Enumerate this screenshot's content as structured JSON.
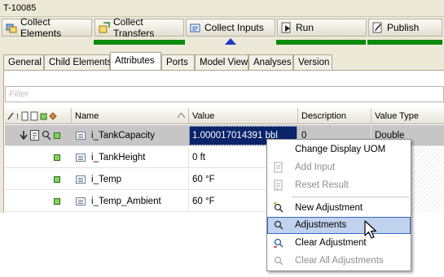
{
  "window": {
    "title": "T-10085"
  },
  "toolbar": {
    "buttons": [
      {
        "label": "Collect Elements",
        "icon": "collect-elements-icon"
      },
      {
        "label": "Collect Transfers",
        "icon": "collect-transfers-icon"
      },
      {
        "label": "Collect Inputs",
        "icon": "collect-inputs-icon"
      },
      {
        "label": "Run",
        "icon": "run-icon"
      },
      {
        "label": "Publish",
        "icon": "publish-icon"
      }
    ]
  },
  "tabs": [
    "General",
    "Child Elements",
    "Attributes",
    "Ports",
    "Model View",
    "Analyses",
    "Version"
  ],
  "active_tab": "Attributes",
  "filter": {
    "placeholder": "Filter"
  },
  "grid": {
    "columns": [
      "Name",
      "Value",
      "Description",
      "Value Type"
    ],
    "rows": [
      {
        "name": "i_TankCapacity",
        "value": "1.000017014391 bbl",
        "description": "0",
        "value_type": "Double",
        "selected": true
      },
      {
        "name": "i_TankHeight",
        "value": "0 ft",
        "description": "",
        "value_type": "",
        "selected": false
      },
      {
        "name": "i_Temp",
        "value": "60 °F",
        "description": "",
        "value_type": "",
        "selected": false
      },
      {
        "name": "i_Temp_Ambient",
        "value": "60 °F",
        "description": "",
        "value_type": "",
        "selected": false
      }
    ]
  },
  "context_menu": {
    "items": [
      {
        "label": "Change Display UOM",
        "enabled": true
      },
      {
        "label": "Add Input",
        "enabled": false
      },
      {
        "label": "Reset Result",
        "enabled": false
      },
      {
        "label": "New Adjustment",
        "enabled": true
      },
      {
        "label": "Adjustments",
        "enabled": true,
        "highlighted": true
      },
      {
        "label": "Clear Adjustment",
        "enabled": true
      },
      {
        "label": "Clear All Adjustments",
        "enabled": false
      }
    ]
  },
  "colors": {
    "selection": "#0a246a",
    "menu_highlight": "#c1d2ee",
    "progress": "#0a8a0a",
    "progress_marker": "#1c39c9"
  }
}
